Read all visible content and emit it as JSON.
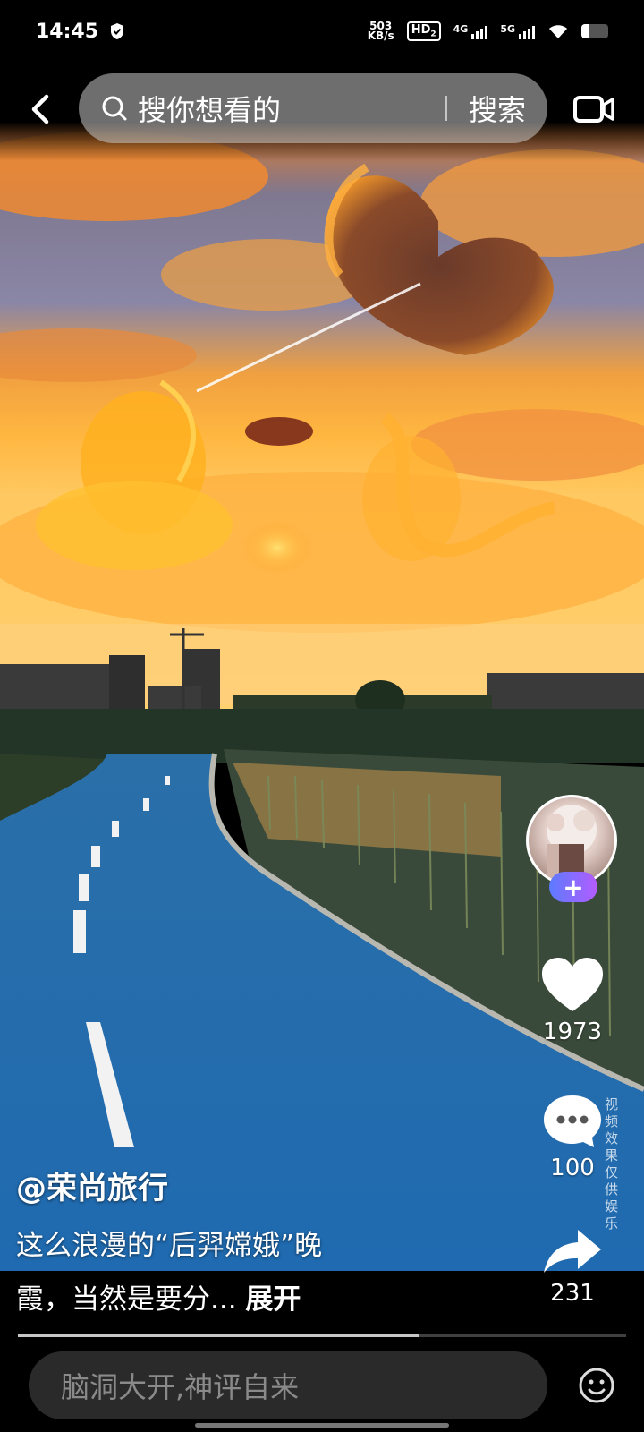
{
  "status_bar": {
    "time": "14:45",
    "net_speed_value": "503",
    "net_speed_unit": "KB/s",
    "hd_label": "HD",
    "hd_sub": "2",
    "signal1_label": "4G",
    "signal2_label": "5G",
    "battery_level": 0.3
  },
  "header": {
    "search_placeholder": "搜你想看的",
    "search_button": "搜索"
  },
  "sidebar": {
    "like_count": "1973",
    "comment_count": "100",
    "share_count": "231",
    "follow_symbol": "+"
  },
  "video": {
    "author": "@荣尚旅行",
    "caption_line1": "这么浪漫的“后羿嫦娥”晚",
    "caption_line2": "霞，当然是要分...",
    "expand_label": "展开",
    "watermark": "视频效果仅供娱乐",
    "progress": 0.66
  },
  "bottom": {
    "comment_placeholder": "脑洞大开,神评自来"
  }
}
